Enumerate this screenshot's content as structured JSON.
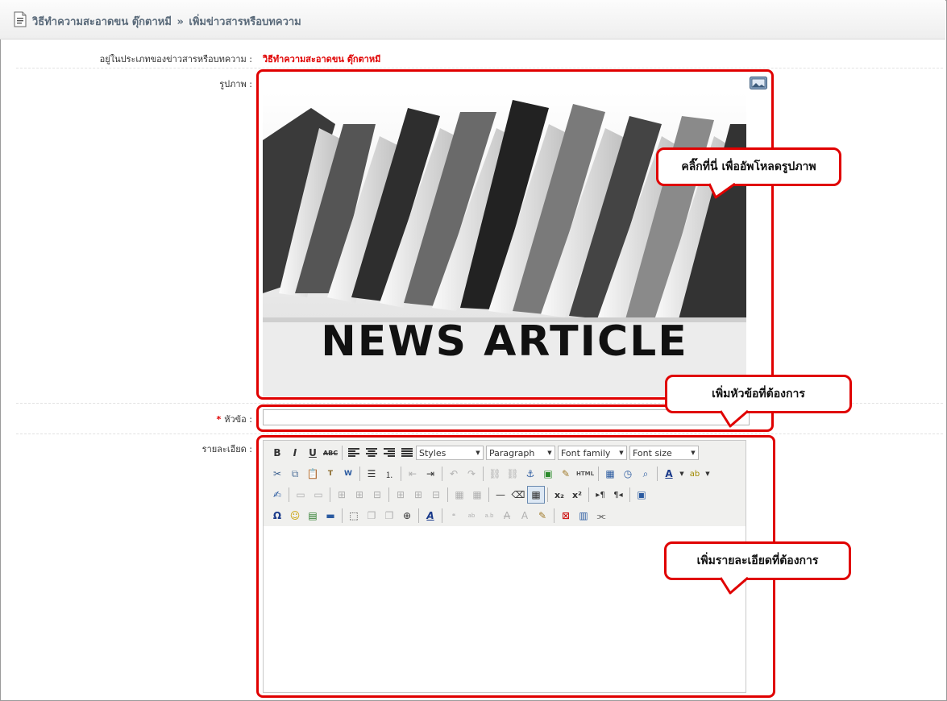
{
  "header": {
    "breadcrumb_category": "วิธีทำความสะอาดขน ตุ๊กตาหมี",
    "breadcrumb_separator": "»",
    "breadcrumb_page": "เพิ่มข่าวสารหรือบทความ"
  },
  "form": {
    "category_label": "อยู่ในประเภทของข่าวสารหรือบทความ :",
    "category_value": "วิธีทำความสะอาดขน ตุ๊กตาหมี",
    "image_label": "รูปภาพ :",
    "image_text": "NEWS ARTICLE",
    "title_required": "*",
    "title_label": "หัวข้อ :",
    "title_value": "",
    "detail_label": "รายละเอียด :"
  },
  "editor": {
    "styles_select": "Styles",
    "format_select": "Paragraph",
    "font_family_select": "Font family",
    "font_size_select": "Font size",
    "html_button": "HTML",
    "body_text": ""
  },
  "callouts": {
    "upload_hint": "คลิ๊กที่นี่ เพื่ออัพโหลดรูปภาพ",
    "title_hint": "เพิ่มหัวข้อที่ต้องการ",
    "detail_hint": "เพิ่มรายละเอียดที่ต้องการ"
  },
  "colors": {
    "accent_red": "#e00000",
    "header_text": "#5a6a7a"
  }
}
